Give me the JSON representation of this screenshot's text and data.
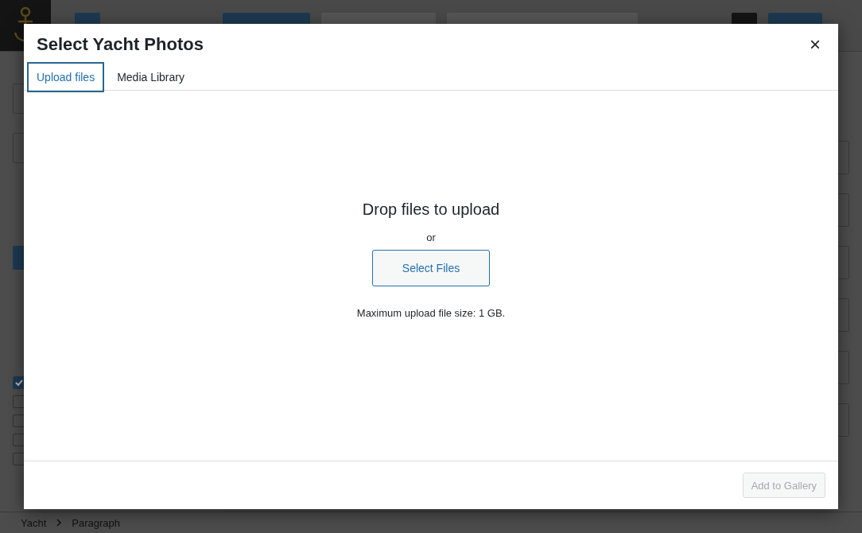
{
  "dialog": {
    "title": "Select Yacht Photos",
    "close": "×",
    "tabs": [
      {
        "label": "Upload files",
        "selected": true
      },
      {
        "label": "Media Library",
        "selected": false
      }
    ],
    "uploader": {
      "heading": "Drop files to upload",
      "separator": "or",
      "button": "Select Files",
      "note": "Maximum upload file size: 1 GB."
    },
    "footer_button": {
      "label": "Add to Gallery",
      "disabled": true
    }
  },
  "side_checkboxes": [
    {
      "checked": true
    },
    {
      "checked": false
    },
    {
      "checked": false
    },
    {
      "checked": false
    },
    {
      "checked": false
    }
  ],
  "breadcrumb": [
    {
      "label": "Yacht"
    },
    {
      "label": "Paragraph"
    }
  ]
}
